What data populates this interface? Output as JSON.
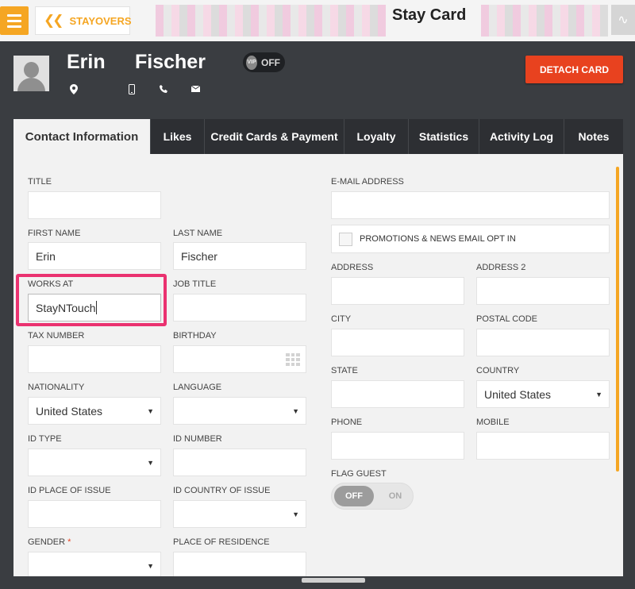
{
  "topbar": {
    "back_label": "STAYOVERS",
    "title": "Stay Card"
  },
  "guest": {
    "first_name": "Erin",
    "last_name": "Fischer",
    "vip_badge": "VIP",
    "vip_state": "OFF",
    "detach_label": "DETACH CARD"
  },
  "tabs": [
    {
      "label": "Contact Information"
    },
    {
      "label": "Likes"
    },
    {
      "label": "Credit Cards & Payment"
    },
    {
      "label": "Loyalty"
    },
    {
      "label": "Statistics"
    },
    {
      "label": "Activity Log"
    },
    {
      "label": "Notes"
    }
  ],
  "form": {
    "title_label": "TITLE",
    "title_value": "",
    "first_name_label": "FIRST NAME",
    "first_name_value": "Erin",
    "last_name_label": "LAST NAME",
    "last_name_value": "Fischer",
    "works_at_label": "WORKS AT",
    "works_at_value": "StayNTouch",
    "job_title_label": "JOB TITLE",
    "tax_number_label": "TAX NUMBER",
    "birthday_label": "BIRTHDAY",
    "nationality_label": "NATIONALITY",
    "nationality_value": "United States",
    "language_label": "LANGUAGE",
    "id_type_label": "ID TYPE",
    "id_number_label": "ID NUMBER",
    "id_place_label": "ID PLACE OF ISSUE",
    "id_country_label": "ID COUNTRY OF ISSUE",
    "gender_label": "GENDER",
    "gender_required": "*",
    "residence_label": "PLACE OF RESIDENCE",
    "email_label": "E-MAIL ADDRESS",
    "promo_label": "PROMOTIONS & NEWS EMAIL OPT IN",
    "address_label": "ADDRESS",
    "address2_label": "ADDRESS 2",
    "city_label": "CITY",
    "postal_label": "POSTAL CODE",
    "state_label": "STATE",
    "country_label": "COUNTRY",
    "country_value": "United States",
    "phone_label": "PHONE",
    "mobile_label": "MOBILE",
    "flag_label": "FLAG GUEST",
    "flag_off": "OFF",
    "flag_on": "ON"
  },
  "colors": {
    "accent": "#f5a623",
    "detach": "#e8421f",
    "highlight": "#ea3270",
    "dark_bg": "#3a3d41"
  }
}
